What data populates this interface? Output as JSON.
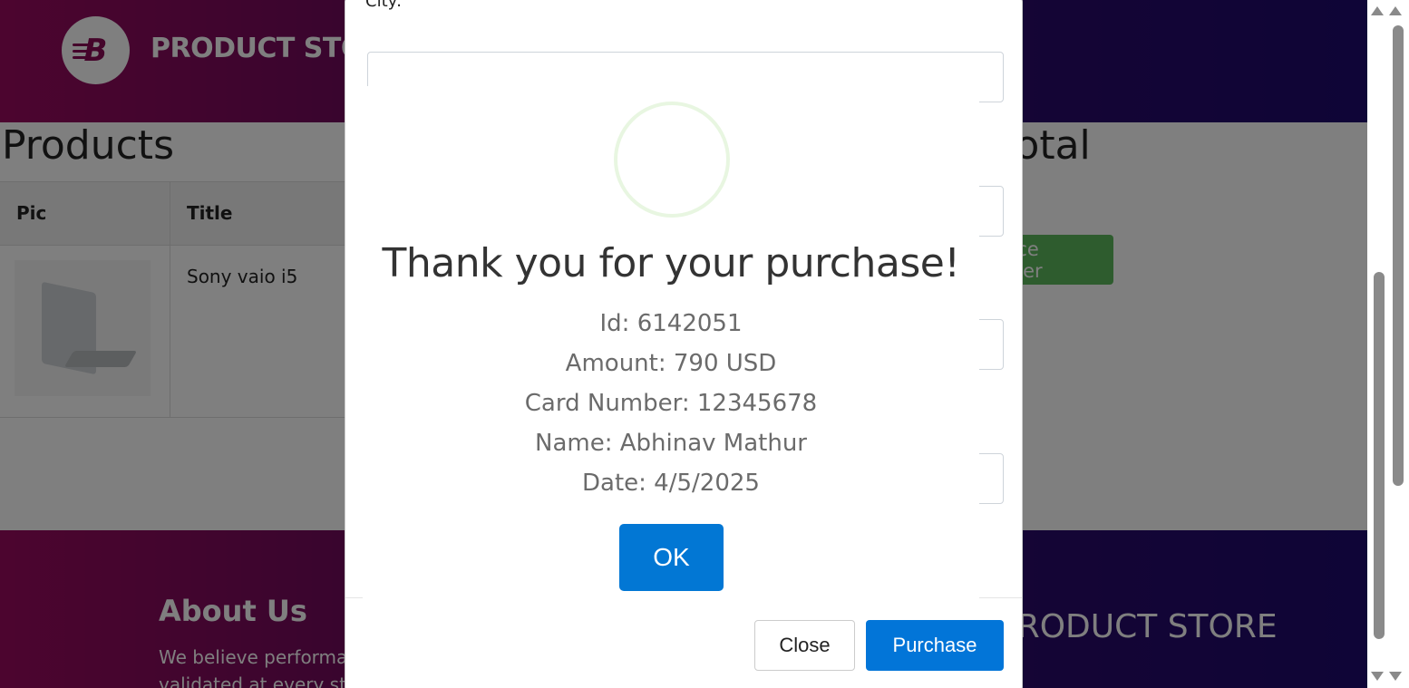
{
  "header": {
    "logo_letter": "B",
    "brand": "PRODUCT STORE"
  },
  "cart": {
    "products_title": "Products",
    "total_title": "Total",
    "columns": [
      "Pic",
      "Title"
    ],
    "rows": [
      {
        "title": "Sony vaio i5"
      }
    ],
    "place_order_label": "Place Order"
  },
  "footer": {
    "about_title": "About Us",
    "about_text": [
      "We believe performance needs to be",
      "validated at every stage"
    ],
    "brand": "PRODUCT STORE"
  },
  "modal": {
    "city_label": "City:",
    "close_label": "Close",
    "purchase_label": "Purchase"
  },
  "alert": {
    "title": "Thank you for your purchase!",
    "lines": [
      "Id: 6142051",
      "Amount: 790 USD",
      "Card Number: 12345678",
      "Name: Abhinav Mathur",
      "Date: 4/5/2025"
    ],
    "ok_label": "OK",
    "success_color": "#a5dc86",
    "button_color": "#0277d4"
  }
}
